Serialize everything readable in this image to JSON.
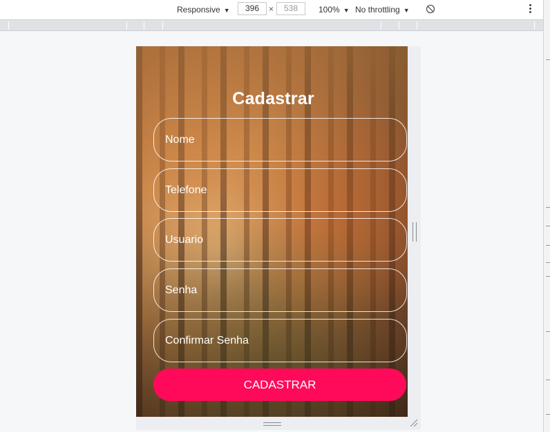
{
  "toolbar": {
    "device_mode": "Responsive",
    "width": "396",
    "height": "538",
    "zoom": "100%",
    "throttling": "No throttling",
    "dropdown_icon": "triangle-down-icon",
    "rotate_icon": "rotate-icon",
    "more_icon": "more-vertical-icon"
  },
  "page": {
    "title": "Cadastrar",
    "fields": [
      {
        "placeholder": "Nome"
      },
      {
        "placeholder": "Telefone"
      },
      {
        "placeholder": "Usuario"
      },
      {
        "placeholder": "Senha"
      },
      {
        "placeholder": "Confirmar Senha"
      }
    ],
    "submit_label": "CADASTRAR",
    "button_color": "#ff0a5a",
    "text_color": "#ffffff"
  }
}
